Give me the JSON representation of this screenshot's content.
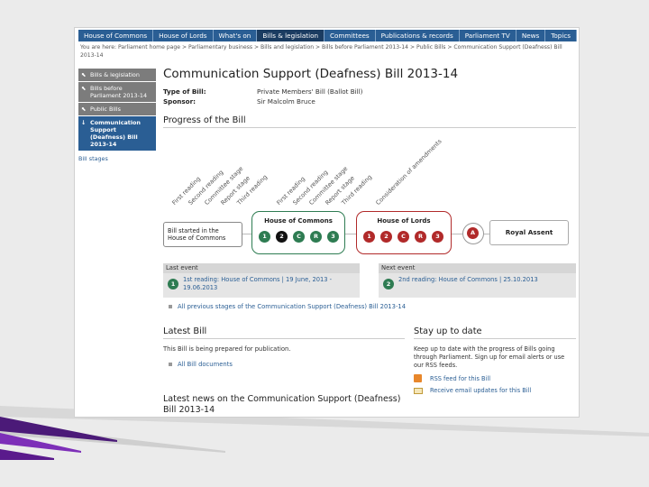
{
  "topnav": {
    "items": [
      "House of Commons",
      "House of Lords",
      "What's on",
      "Bills & legislation",
      "Committees",
      "Publications & records",
      "Parliament TV",
      "News",
      "Topics"
    ],
    "active_index": 3
  },
  "breadcrumb": "You are here: Parliament home page > Parliamentary business > Bills and legislation > Bills before Parliament 2013-14 > Public Bills > Communication Support (Deafness) Bill 2013-14",
  "sidebar": {
    "items": [
      {
        "label": "Bills & legislation",
        "icon": "collapse-icon"
      },
      {
        "label": "Bills before Parliament 2013-14",
        "icon": "collapse-icon"
      },
      {
        "label": "Public Bills",
        "icon": "collapse-icon"
      },
      {
        "label": "Communication Support (Deafness) Bill 2013-14",
        "icon": "arrow-icon"
      }
    ],
    "active_index": 3,
    "link": "Bill stages"
  },
  "main": {
    "title": "Communication Support (Deafness) Bill 2013-14",
    "type_label": "Type of Bill:",
    "type_value": "Private Members' Bill (Ballot Bill)",
    "sponsor_label": "Sponsor:",
    "sponsor_value": "Sir Malcolm Bruce",
    "progress_heading": "Progress of the Bill"
  },
  "stages": {
    "commons_labels": [
      "First reading",
      "Second reading",
      "Committee stage",
      "Report stage",
      "Third reading"
    ],
    "lords_labels": [
      "First reading",
      "Second reading",
      "Committee stage",
      "Report stage",
      "Third reading"
    ],
    "final_label": "Consideration of amendments"
  },
  "tracker": {
    "started": "Bill started in the House of Commons",
    "commons": {
      "name": "House of Commons",
      "stages": [
        "1",
        "2",
        "C",
        "R",
        "3"
      ],
      "current_index": 1
    },
    "lords": {
      "name": "House of Lords",
      "stages": [
        "1",
        "2",
        "C",
        "R",
        "3"
      ]
    },
    "amendments_stage": "A",
    "assent": "Royal Assent"
  },
  "events": {
    "last_label": "Last event",
    "last_num": "1",
    "last_text": "1st reading: House of Commons | 19 June, 2013 - 19.06.2013",
    "next_label": "Next event",
    "next_num": "2",
    "next_text": "2nd reading: House of Commons | 25.10.2013"
  },
  "previous_link": "All previous stages of the Communication Support (Deafness) Bill 2013-14",
  "latest_bill": {
    "heading": "Latest Bill",
    "text": "This Bill is being prepared for publication.",
    "link": "All Bill documents"
  },
  "stay": {
    "heading": "Stay up to date",
    "text": "Keep up to date with the progress of Bills going through Parliament. Sign up for email alerts or use our RSS feeds.",
    "rss": "RSS feed for this Bill",
    "email": "Receive email updates for this Bill"
  },
  "latest_news": "Latest news on the Communication Support (Deafness) Bill 2013-14",
  "colors": {
    "nav_blue": "#2a5e94",
    "commons_green": "#2e7c52",
    "lords_red": "#b12a2a",
    "deco_purple": "#5a1a8c"
  }
}
